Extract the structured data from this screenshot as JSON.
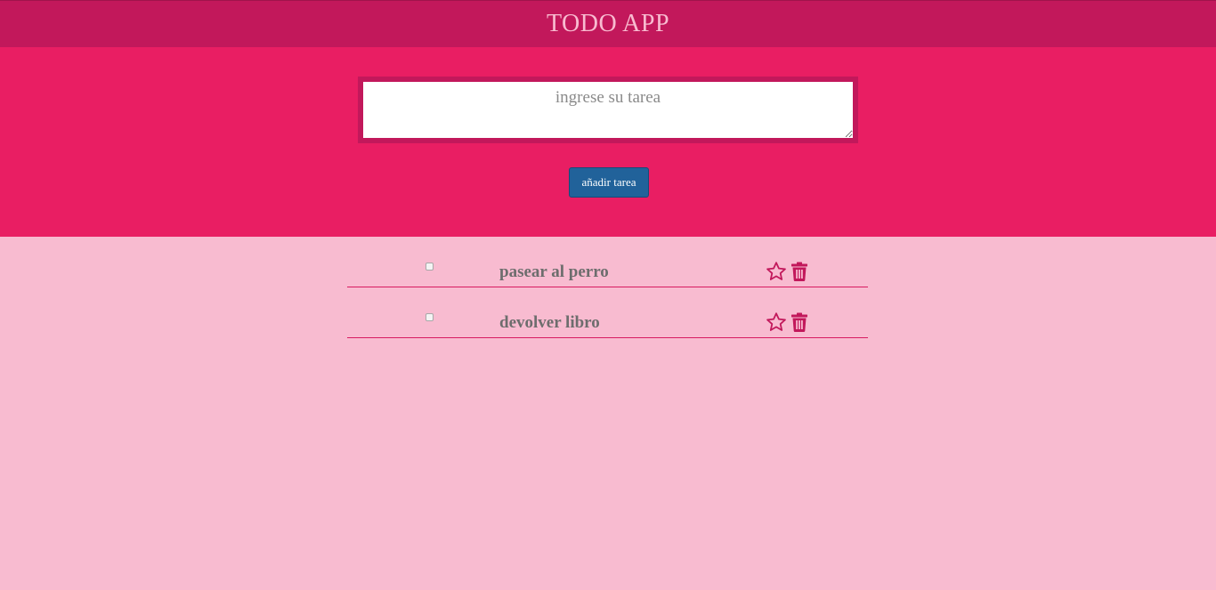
{
  "app": {
    "title": "TODO APP"
  },
  "form": {
    "placeholder": "ingrese su tarea",
    "value": "",
    "add_label": "añadir tarea"
  },
  "tasks": [
    {
      "label": "pasear al perro",
      "completed": false,
      "starred": false
    },
    {
      "label": "devolver libro",
      "completed": false,
      "starred": false
    }
  ],
  "icons": {
    "star": "star-icon",
    "delete": "trash-icon"
  },
  "colors": {
    "header_bg": "#c2185b",
    "section_bg": "#e91e63",
    "page_bg": "#f8bbd0",
    "button_bg": "#21629a",
    "icon_color": "#c2185b"
  }
}
